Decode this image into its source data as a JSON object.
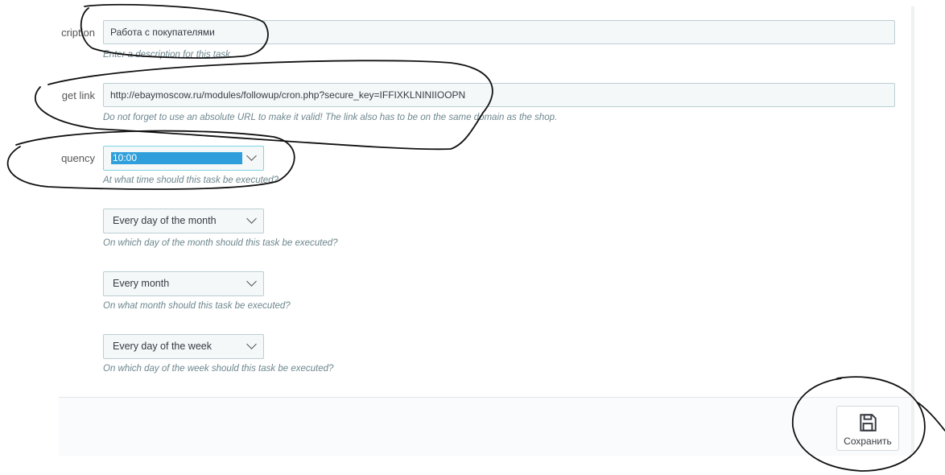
{
  "form": {
    "description": {
      "label": "cription",
      "value": "Работа с покупателями",
      "help": "Enter a description for this task."
    },
    "target_link": {
      "label": "get link",
      "value": "http://ebaymoscow.ru/modules/followup/cron.php?secure_key=IFFIXKLNINIIOOPN",
      "help": "Do not forget to use an absolute URL to make it valid! The link also has to be on the same domain as the shop."
    },
    "frequency": {
      "label": "quency",
      "hour_value": "10:00",
      "hour_help": "At what time should this task be executed?",
      "day_value": "Every day of the month",
      "day_help": "On which day of the month should this task be executed?",
      "month_value": "Every month",
      "month_help": "On what month should this task be executed?",
      "weekday_value": "Every day of the week",
      "weekday_help": "On which day of the week should this task be executed?"
    }
  },
  "footer": {
    "save_label": "Сохранить",
    "save_icon": "floppy-disk-icon"
  },
  "colors": {
    "selection_highlight": "#2f9fdb",
    "input_background": "#f5f8f9",
    "input_border": "#bbcdd2"
  }
}
